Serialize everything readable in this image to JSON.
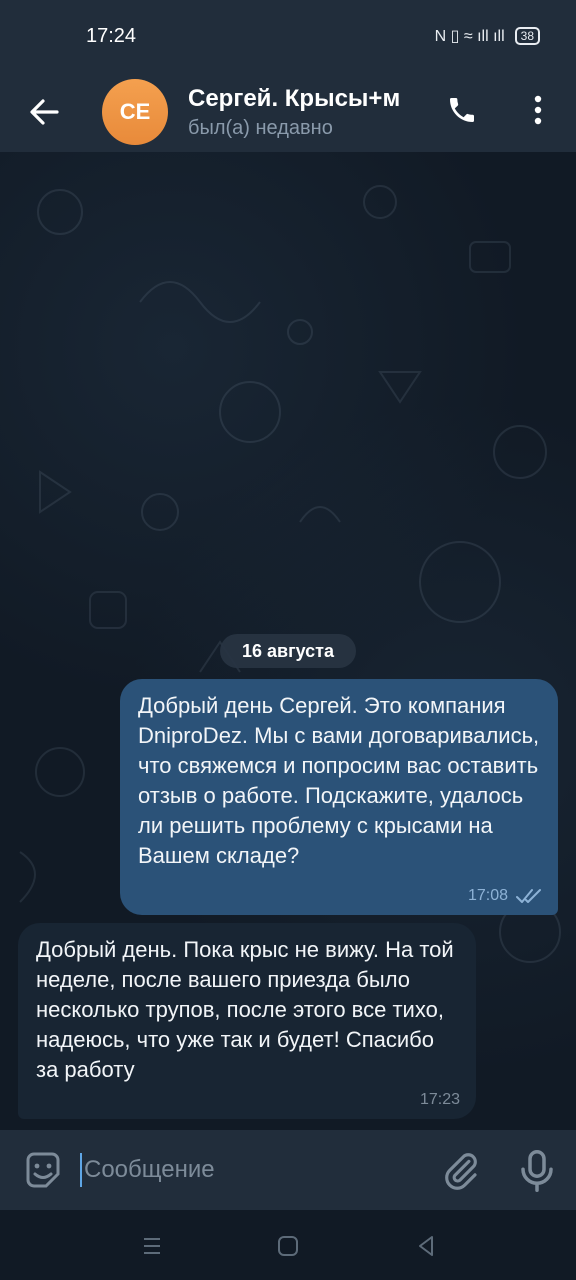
{
  "status": {
    "time": "17:24",
    "battery": "38",
    "signal_icons": "N ▯ ≈ ıll ıll"
  },
  "header": {
    "avatar_initials": "CE",
    "title": "Сергей. Крысы+м",
    "subtitle": "был(а) недавно",
    "avatar_color": "#f0984a"
  },
  "chat": {
    "date": "16 августа",
    "messages": [
      {
        "direction": "out",
        "text": "Добрый день Сергей. Это компания DniproDez. Мы с вами договаривались, что свяжемся и попросим вас оставить отзыв о работе. Подскажите, удалось ли решить проблему с крысами на Вашем складе?",
        "time": "17:08",
        "status": "read"
      },
      {
        "direction": "in",
        "text": "Добрый день. Пока крыс не вижу. На той неделе, после вашего приезда было несколько трупов, после этого все тихо, надеюсь, что уже так и будет! Спасибо за работу",
        "time": "17:23"
      }
    ]
  },
  "composer": {
    "placeholder": "Сообщение"
  },
  "colors": {
    "out_bubble": "#2b5278",
    "in_bubble": "#182533",
    "header": "#212d3b"
  }
}
